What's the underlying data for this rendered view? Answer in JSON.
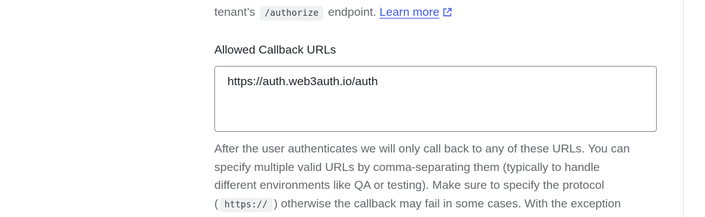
{
  "top_line": {
    "prefix": "tenant’s",
    "code": "/authorize",
    "middle": "endpoint.",
    "link": "Learn more",
    "link_icon": "external-link-icon"
  },
  "callback_urls": {
    "label": "Allowed Callback URLs",
    "value": "https://auth.web3auth.io/auth"
  },
  "help": {
    "line1": "After the user authenticates we will only call back to any of these URLs. You can",
    "line2": "specify multiple valid URLs by comma-separating them (typically to handle",
    "line3": "different environments like QA or testing). Make sure to specify the protocol",
    "line4_open": "(",
    "line4_code": "https://",
    "line4_rest": ") otherwise the callback may fail in some cases. With the exception"
  },
  "colors": {
    "link": "#3f59e4",
    "muted_text": "#65676e",
    "heading_text": "#1e212a",
    "code_bg": "#f0f1f3",
    "field_border": "#8a8c93"
  }
}
